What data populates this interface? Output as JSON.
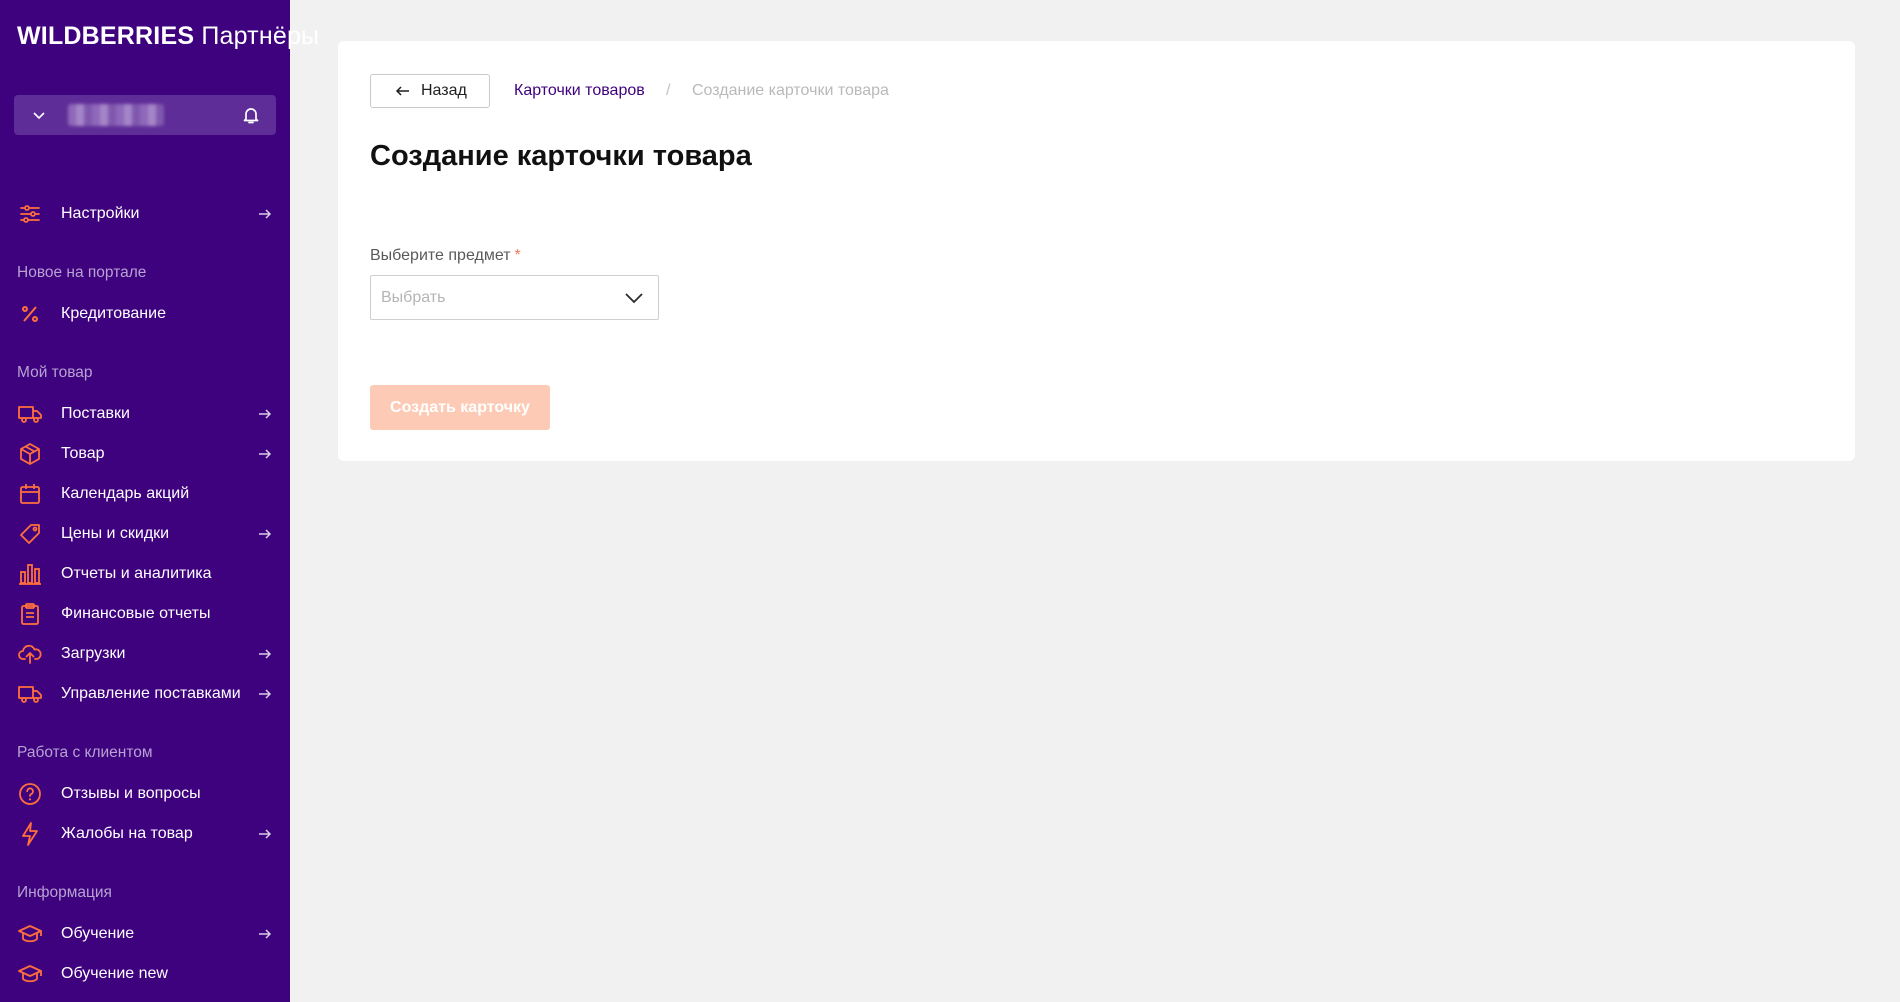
{
  "logo": {
    "brand": "WILDBERRIES",
    "sub": "Партнёры"
  },
  "sidebar": {
    "settings": "Настройки",
    "sections": {
      "new": "Новое на портале",
      "goods": "Мой товар",
      "clients": "Работа с клиентом",
      "info": "Информация"
    },
    "items": {
      "credit": "Кредитование",
      "supplies": "Поставки",
      "product": "Товар",
      "calendar": "Календарь акций",
      "prices": "Цены и скидки",
      "reports": "Отчеты и аналитика",
      "finance": "Финансовые отчеты",
      "uploads": "Загрузки",
      "supply_mgmt": "Управление поставками",
      "reviews": "Отзывы и вопросы",
      "complaints": "Жалобы на товар",
      "learning": "Обучение",
      "learning_new": "Обучение new"
    }
  },
  "main": {
    "back_label": "Назад",
    "breadcrumb": {
      "link": "Карточки товаров",
      "separator": "/",
      "current": "Создание карточки товара"
    },
    "title": "Создание карточки товара",
    "field_label": "Выберите предмет",
    "required_mark": "*",
    "select_placeholder": "Выбрать",
    "create_button": "Создать карточку"
  },
  "colors": {
    "sidebar": "#3e027f",
    "accent": "#ff6f3c",
    "disabled_button": "#fdcbb5"
  },
  "icons": [
    "chevron-down-icon",
    "bell-icon",
    "sliders-icon",
    "percent-icon",
    "truck-icon",
    "box-icon",
    "calendar-icon",
    "tag-icon",
    "bar-chart-icon",
    "clipboard-icon",
    "upload-cloud-icon",
    "question-circle-icon",
    "lightning-icon",
    "graduation-cap-icon",
    "arrow-right-icon",
    "arrow-left-icon"
  ]
}
